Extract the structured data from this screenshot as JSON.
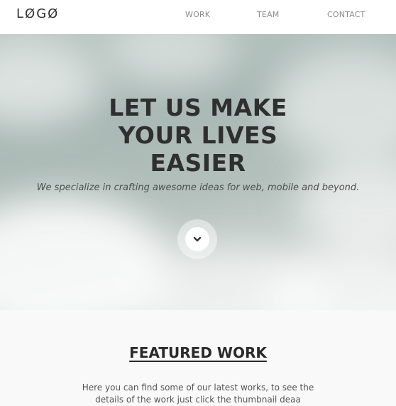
{
  "header": {
    "logo": "LØGØ",
    "nav": {
      "work": "WORK",
      "team": "TEAM",
      "contact": "CONTACT"
    }
  },
  "hero": {
    "title_lines": [
      "LET US MAKE",
      "YOUR LIVES",
      "EASIER"
    ],
    "subtitle": "We specialize in crafting awesome ideas for web, mobile and beyond.",
    "scroll_icon": "chevron-down-icon"
  },
  "featured": {
    "title": "FEATURED WORK",
    "text": "Here you can find some of our latest works, to see the details of the work just click the thumbnail deaa"
  },
  "colors": {
    "header_bg": "#ffffff",
    "text_dark": "#2f2f2f",
    "nav_text": "#8a8a8a",
    "section_bg": "#f9f9f9"
  }
}
